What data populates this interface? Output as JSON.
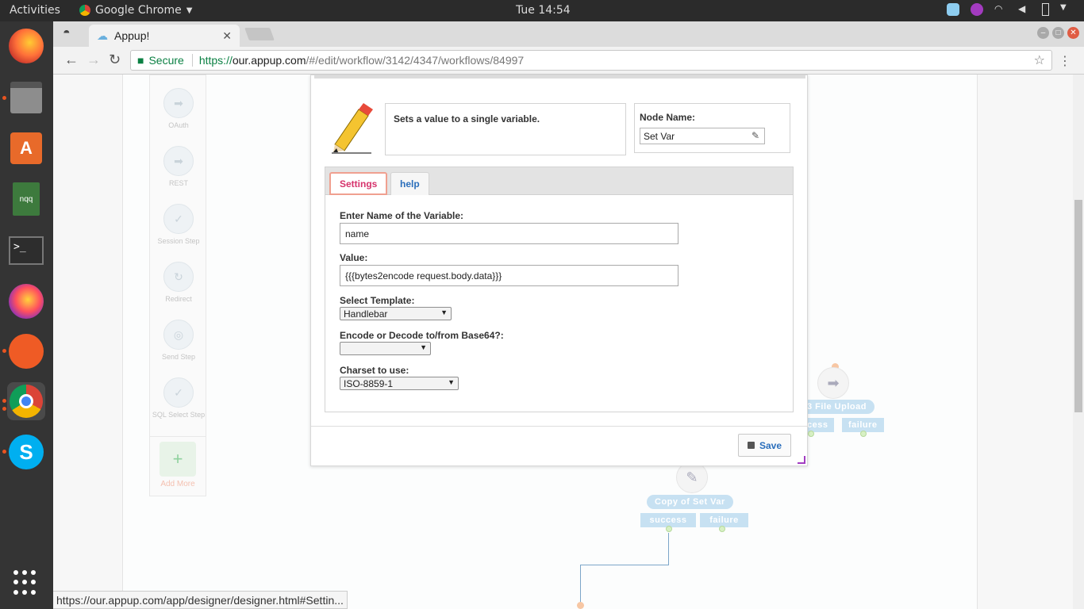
{
  "topbar": {
    "activities": "Activities",
    "app_name": "Google Chrome",
    "clock": "Tue 14:54"
  },
  "dock": {
    "apps": [
      "firefox-icon",
      "files-icon",
      "software-center-icon",
      "nqq-icon",
      "terminal-icon",
      "firefox-dev-icon",
      "postman-icon",
      "chrome-icon",
      "skype-icon"
    ],
    "nqq_label": "nqq"
  },
  "browser": {
    "tab_title": "Appup!",
    "url_secure": "Secure",
    "url_scheme": "https://",
    "url_host": "our.appup.com",
    "url_path": "/#/edit/workflow/3142/4347/workflows/84997",
    "status_url": "https://our.appup.com/app/designer/designer.html#Settin..."
  },
  "palette": {
    "items": [
      {
        "label": "OAuth"
      },
      {
        "label": "REST"
      },
      {
        "label": "Session Step"
      },
      {
        "label": "Redirect"
      },
      {
        "label": "Send Step"
      },
      {
        "label": "SQL Select Step"
      }
    ],
    "add_more": "Add More"
  },
  "workflow": {
    "node1_label": "3 File Upload",
    "node1_success": "cess",
    "node1_failure": "failure",
    "node2_label": "Copy of Set Var",
    "node2_success": "success",
    "node2_failure": "failure"
  },
  "modal": {
    "description": "Sets a value to a single variable.",
    "node_name_label": "Node Name:",
    "node_name_value": "Set Var",
    "tabs": {
      "settings": "Settings",
      "help": "help"
    },
    "fields": {
      "var_name_label": "Enter Name of the Variable:",
      "var_name_value": "name",
      "value_label": "Value:",
      "value_value": "{{{bytes2encode request.body.data}}}",
      "template_label": "Select Template:",
      "template_value": "Handlebar",
      "encode_label": "Encode or Decode to/from Base64?:",
      "encode_value": "",
      "charset_label": "Charset to use:",
      "charset_value": "ISO-8859-1"
    },
    "save_label": "Save"
  }
}
